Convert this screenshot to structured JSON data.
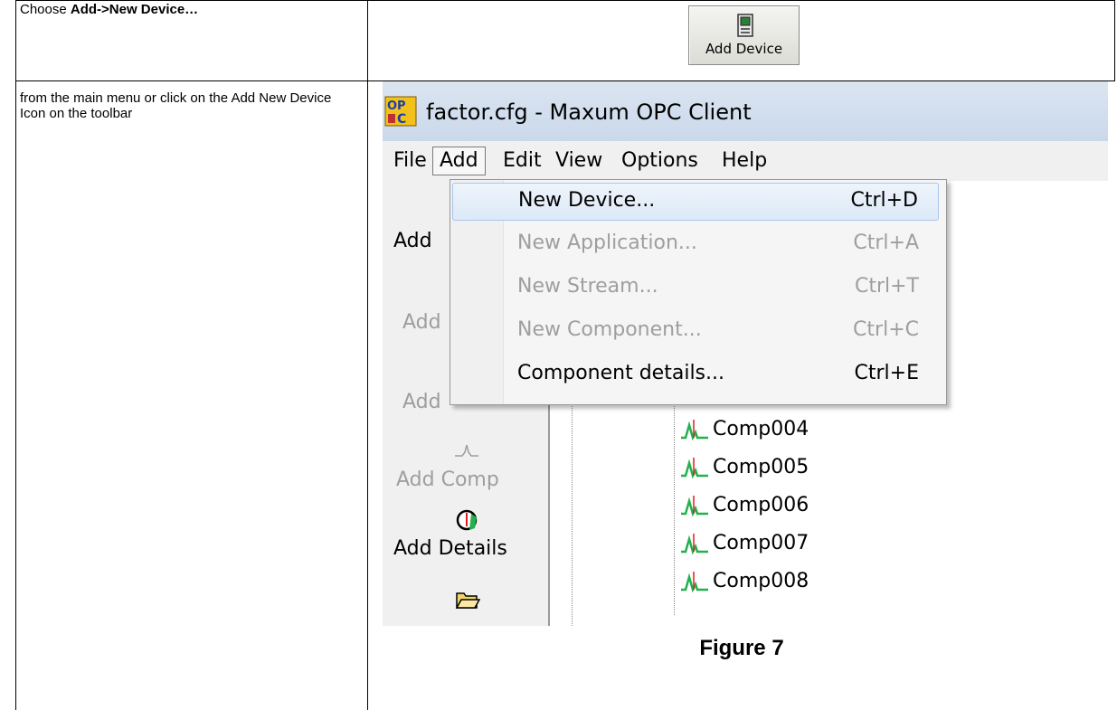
{
  "instructions": {
    "row1_prefix": "Choose ",
    "row1_bold": "Add->New Device…",
    "row2_text": "from the main menu or click on the Add New Device Icon on the toolbar"
  },
  "toolbar_button": {
    "label": "Add Device",
    "icon": "device-icon"
  },
  "app": {
    "title": "factor.cfg - Maxum  OPC  Client",
    "menu": [
      "File",
      "Add",
      "Edit",
      "View",
      "Options",
      "Help"
    ],
    "active_menu": "Add"
  },
  "dropdown": {
    "items": [
      {
        "label": "New Device...",
        "shortcut": "Ctrl+D",
        "enabled": true,
        "highlighted": true
      },
      {
        "label": "New Application...",
        "shortcut": "Ctrl+A",
        "enabled": false
      },
      {
        "label": "New Stream...",
        "shortcut": "Ctrl+T",
        "enabled": false
      },
      {
        "label": "New Component...",
        "shortcut": "Ctrl+C",
        "enabled": false
      },
      {
        "label": "Component details...",
        "shortcut": "Ctrl+E",
        "enabled": true
      }
    ]
  },
  "left_toolbar": {
    "add_device": "Add",
    "add_app": "Add",
    "add_stream": "Add",
    "add_comp": "Add Comp",
    "add_details": "Add Details"
  },
  "tree": {
    "items": [
      "Comp004",
      "Comp005",
      "Comp006",
      "Comp007",
      "Comp008"
    ]
  },
  "caption": "Figure 7",
  "colors": {
    "peak_green": "#22b14c",
    "peak_red": "#e31a1c",
    "highlight": "#dde9f7"
  }
}
